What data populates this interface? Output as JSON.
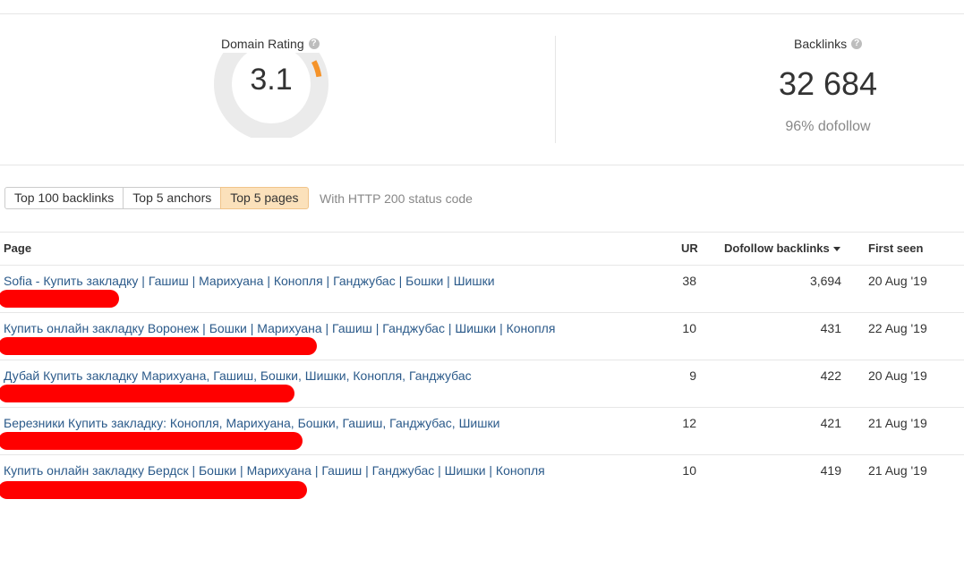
{
  "metrics": {
    "domain_rating": {
      "label": "Domain Rating",
      "value": "3.1",
      "gauge_fraction": 0.031
    },
    "backlinks": {
      "label": "Backlinks",
      "value": "32 684",
      "dofollow_text": "96% dofollow"
    }
  },
  "colors": {
    "accent": "#f5932a",
    "gauge_track": "#ebebeb",
    "link": "#2b5a8a",
    "active_tab": "#fbe1bb",
    "redaction": "#ff0000"
  },
  "tabs": [
    {
      "label": "Top 100 backlinks"
    },
    {
      "label": "Top 5 anchors"
    },
    {
      "label": "Top 5 pages"
    }
  ],
  "tabs_note": "With HTTP 200 status code",
  "table": {
    "headers": {
      "page": "Page",
      "ur": "UR",
      "dofollow": "Dofollow backlinks",
      "first_seen": "First seen"
    },
    "rows": [
      {
        "page": "Sofia - Купить закладку | Гашиш | Марихуана | Конопля | Ганджубас | Бошки | Шишки",
        "ur": "38",
        "dofollow": "3,694",
        "first_seen": "20 Aug '19"
      },
      {
        "page": "Купить онлайн закладку Воронеж | Бошки | Марихуана | Гашиш | Ганджубас | Шишки | Конопля",
        "ur": "10",
        "dofollow": "431",
        "first_seen": "22 Aug '19"
      },
      {
        "page": "Дубай Купить закладку Марихуана, Гашиш, Бошки, Шишки, Конопля, Ганджубас",
        "ur": "9",
        "dofollow": "422",
        "first_seen": "20 Aug '19"
      },
      {
        "page": "Березники Купить закладку: Конопля, Марихуана, Бошки, Гашиш, Ганджубас, Шишки",
        "ur": "12",
        "dofollow": "421",
        "first_seen": "21 Aug '19"
      },
      {
        "page": "Купить онлайн закладку Бердск | Бошки | Марихуана | Гашиш | Ганджубас | Шишки | Конопля",
        "ur": "10",
        "dofollow": "419",
        "first_seen": "21 Aug '19"
      }
    ]
  }
}
